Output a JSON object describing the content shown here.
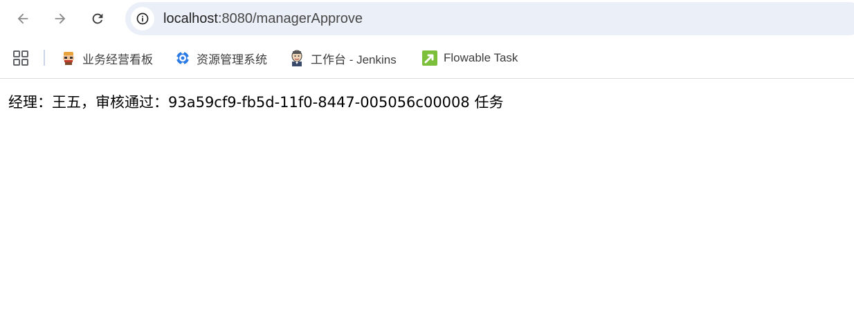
{
  "browser": {
    "url_host": "localhost",
    "url_rest": ":8080/managerApprove"
  },
  "bookmarks": [
    {
      "label": "业务经营看板",
      "icon": "pixel-character-icon"
    },
    {
      "label": "资源管理系统",
      "icon": "gear-icon"
    },
    {
      "label": "工作台 - Jenkins",
      "icon": "jenkins-butler-icon"
    },
    {
      "label": "Flowable Task",
      "icon": "flowable-arrow-icon"
    }
  ],
  "page": {
    "message": "经理：王五，审核通过：93a59cf9-fb5d-11f0-8447-005056c00008 任务"
  },
  "colors": {
    "omnibox_bg": "#ebeff7",
    "flowable_green": "#7cbf3a",
    "resource_blue": "#2c7be5"
  }
}
